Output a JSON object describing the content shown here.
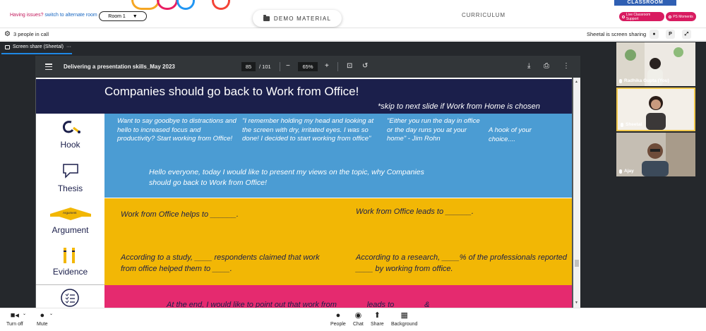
{
  "topbar": {
    "issues_text": "Having issues?",
    "alt_room_link": "switch to alternate room",
    "room_select_value": "Room 1",
    "demo_material_label": "DEMO MATERIAL",
    "curriculum_label": "CURRICULUM",
    "classroom_tab": "CLASSROOM",
    "live_support_label": "Live Classroom Support",
    "ps_moments_label": "PS Moments"
  },
  "callbar": {
    "people_count": "3 people in call",
    "sharing_status": "Sheetal is screen sharing",
    "p_button": "P"
  },
  "share_tab": {
    "label": "Screen share (Sheetal)",
    "more": "···"
  },
  "pdf": {
    "title": "Delivering a presentation skills_May 2023",
    "current_page": "85",
    "total_pages": "/ 101",
    "zoom": "65%",
    "zoom_out": "−",
    "zoom_in": "+"
  },
  "slide": {
    "title": "Companies should go back to Work from Office!",
    "subtitle": "*skip to next slide if Work from Home is chosen",
    "labels": {
      "hook": "Hook",
      "thesis": "Thesis",
      "argument": "Argument",
      "evidence": "Evidence",
      "argument_badge": "Argument"
    },
    "hooks": [
      "Want to say goodbye to distractions and hello to increased focus and productivity? Start working from Office!",
      "\"I remember holding my head and looking at the screen with dry, irritated eyes. I was so done! I decided to start working from office\"",
      "\"Either you run the day in office or the day runs you at your home\" - Jim Rohn",
      "A hook of your choice...."
    ],
    "thesis_text": "Hello everyone, today I would like to present my views on the topic, why Companies should go back to Work from Office!",
    "argument_left": "Work from Office helps to ______.",
    "argument_right": "Work from Office leads to ______.",
    "evidence_left": "According to a study, ____ respondents claimed that work from office helped them to ____.",
    "evidence_right": "According to a research, ____% of the professionals reported ____ by working from office.",
    "conclusion_partial": "At the end, I would like to point out that work from ______ leads to ______ &"
  },
  "participants": [
    {
      "name": "Radhika Gupta (You)"
    },
    {
      "name": "Sheetal"
    },
    {
      "name": "Ajay"
    }
  ],
  "bottombar": {
    "turn_off": "Turn off",
    "mute": "Mute",
    "people": "People",
    "chat": "Chat",
    "share": "Share",
    "background": "Background"
  },
  "colors": {
    "accent_pink": "#d81b60",
    "slide_navy": "#1b1f4b",
    "slide_blue": "#4b9cd3",
    "slide_yellow": "#f2b705",
    "slide_pink": "#e52a6f"
  }
}
